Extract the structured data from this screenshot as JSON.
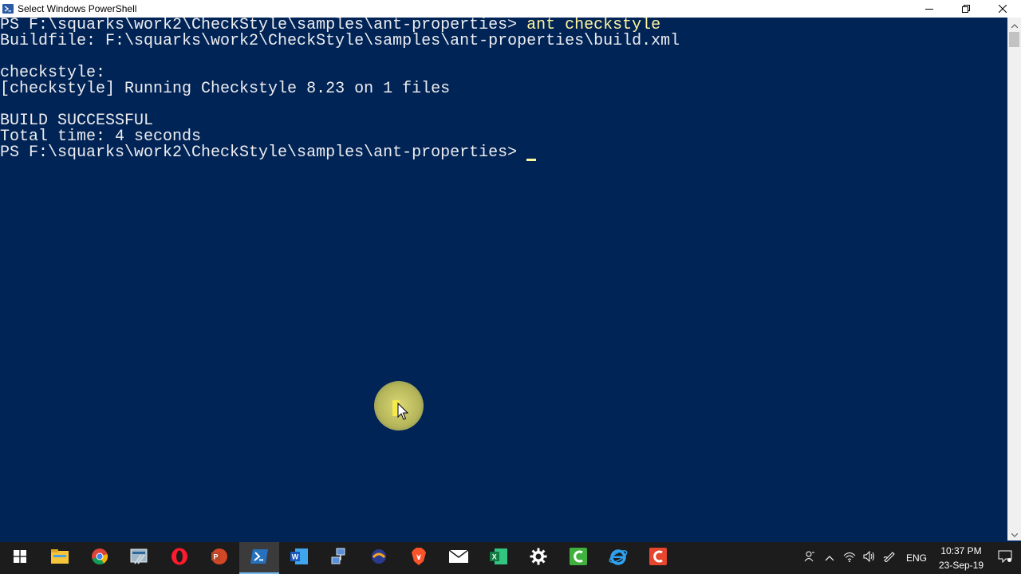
{
  "window": {
    "title": "Select Windows PowerShell"
  },
  "console": {
    "lines": [
      {
        "prompt": "PS F:\\squarks\\work2\\CheckStyle\\samples\\ant-properties> ",
        "command": "ant checkstyle"
      },
      {
        "text": "Buildfile: F:\\squarks\\work2\\CheckStyle\\samples\\ant-properties\\build.xml"
      },
      {
        "text": ""
      },
      {
        "text": "checkstyle:"
      },
      {
        "text": "[checkstyle] Running Checkstyle 8.23 on 1 files"
      },
      {
        "text": ""
      },
      {
        "text": "BUILD SUCCESSFUL"
      },
      {
        "text": "Total time: 4 seconds"
      },
      {
        "prompt": "PS F:\\squarks\\work2\\CheckStyle\\samples\\ant-properties> "
      }
    ]
  },
  "taskbar": {
    "apps": [
      "start-icon",
      "file-explorer-icon",
      "chrome-icon",
      "snipping-tool-icon",
      "opera-icon",
      "powerpoint-icon",
      "powershell-icon",
      "word-icon",
      "network-app-icon",
      "app-icon",
      "brave-icon",
      "mail-icon",
      "excel-icon",
      "settings-icon",
      "camtasia-icon",
      "internet-explorer-icon",
      "camtasia-recorder-icon"
    ],
    "active_app": "powershell-icon",
    "tray": {
      "language": "ENG",
      "time": "10:37 PM",
      "date": "23-Sep-19"
    }
  },
  "colors": {
    "console_bg": "#012456",
    "console_text": "#eeedf0",
    "command_text": "#fff59e",
    "taskbar_bg": "#1c1c1c",
    "accent": "#76b9ed"
  }
}
